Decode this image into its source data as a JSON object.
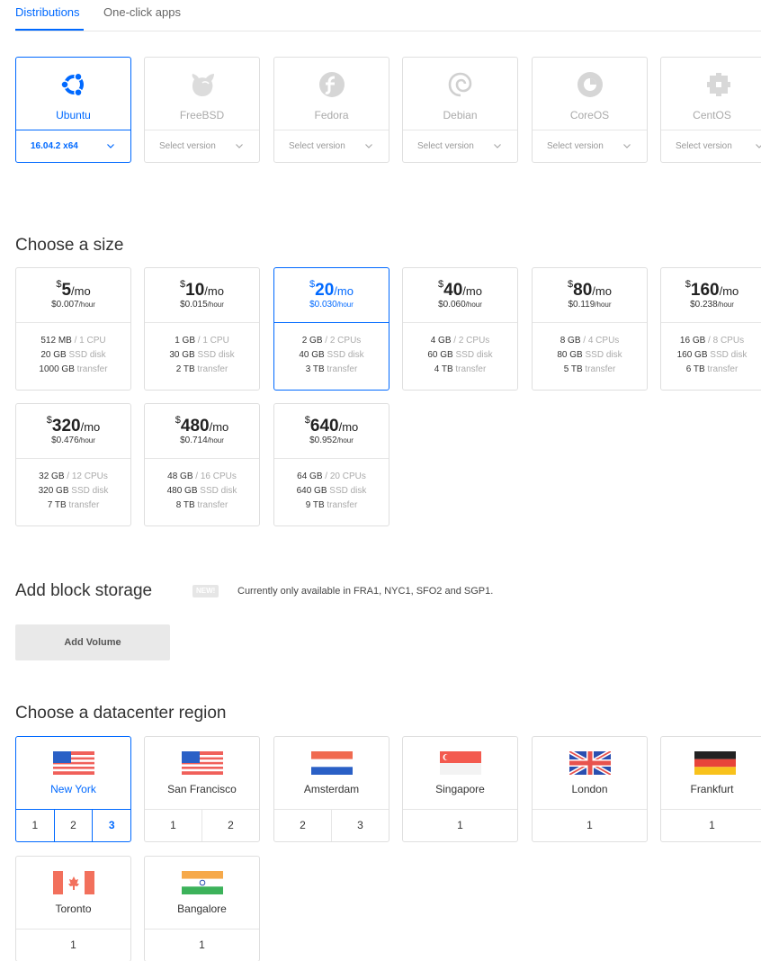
{
  "tabs": [
    {
      "label": "Distributions",
      "active": true
    },
    {
      "label": "One-click apps",
      "active": false
    }
  ],
  "distributions": [
    {
      "name": "Ubuntu",
      "version": "16.04.2 x64",
      "selected": true,
      "icon": "ubuntu-icon"
    },
    {
      "name": "FreeBSD",
      "version": "Select version",
      "selected": false,
      "icon": "freebsd-icon"
    },
    {
      "name": "Fedora",
      "version": "Select version",
      "selected": false,
      "icon": "fedora-icon"
    },
    {
      "name": "Debian",
      "version": "Select version",
      "selected": false,
      "icon": "debian-icon"
    },
    {
      "name": "CoreOS",
      "version": "Select version",
      "selected": false,
      "icon": "coreos-icon"
    },
    {
      "name": "CentOS",
      "version": "Select version",
      "selected": false,
      "icon": "centos-icon"
    }
  ],
  "size_section": {
    "title": "Choose a size",
    "sizes": [
      {
        "currency": "$",
        "price": "5",
        "per": "/mo",
        "hourly": "$0.007",
        "hourly_unit": "/hour",
        "ram": "512 MB",
        "cpu": "1 CPU",
        "disk": "20 GB",
        "disk_type": "SSD disk",
        "transfer": "1000 GB",
        "transfer_label": "transfer",
        "selected": false
      },
      {
        "currency": "$",
        "price": "10",
        "per": "/mo",
        "hourly": "$0.015",
        "hourly_unit": "/hour",
        "ram": "1 GB",
        "cpu": "1 CPU",
        "disk": "30 GB",
        "disk_type": "SSD disk",
        "transfer": "2 TB",
        "transfer_label": "transfer",
        "selected": false
      },
      {
        "currency": "$",
        "price": "20",
        "per": "/mo",
        "hourly": "$0.030",
        "hourly_unit": "/hour",
        "ram": "2 GB",
        "cpu": "2 CPUs",
        "disk": "40 GB",
        "disk_type": "SSD disk",
        "transfer": "3 TB",
        "transfer_label": "transfer",
        "selected": true
      },
      {
        "currency": "$",
        "price": "40",
        "per": "/mo",
        "hourly": "$0.060",
        "hourly_unit": "/hour",
        "ram": "4 GB",
        "cpu": "2 CPUs",
        "disk": "60 GB",
        "disk_type": "SSD disk",
        "transfer": "4 TB",
        "transfer_label": "transfer",
        "selected": false
      },
      {
        "currency": "$",
        "price": "80",
        "per": "/mo",
        "hourly": "$0.119",
        "hourly_unit": "/hour",
        "ram": "8 GB",
        "cpu": "4 CPUs",
        "disk": "80 GB",
        "disk_type": "SSD disk",
        "transfer": "5 TB",
        "transfer_label": "transfer",
        "selected": false
      },
      {
        "currency": "$",
        "price": "160",
        "per": "/mo",
        "hourly": "$0.238",
        "hourly_unit": "/hour",
        "ram": "16 GB",
        "cpu": "8 CPUs",
        "disk": "160 GB",
        "disk_type": "SSD disk",
        "transfer": "6 TB",
        "transfer_label": "transfer",
        "selected": false
      },
      {
        "currency": "$",
        "price": "320",
        "per": "/mo",
        "hourly": "$0.476",
        "hourly_unit": "/hour",
        "ram": "32 GB",
        "cpu": "12 CPUs",
        "disk": "320 GB",
        "disk_type": "SSD disk",
        "transfer": "7 TB",
        "transfer_label": "transfer",
        "selected": false
      },
      {
        "currency": "$",
        "price": "480",
        "per": "/mo",
        "hourly": "$0.714",
        "hourly_unit": "/hour",
        "ram": "48 GB",
        "cpu": "16 CPUs",
        "disk": "480 GB",
        "disk_type": "SSD disk",
        "transfer": "8 TB",
        "transfer_label": "transfer",
        "selected": false
      },
      {
        "currency": "$",
        "price": "640",
        "per": "/mo",
        "hourly": "$0.952",
        "hourly_unit": "/hour",
        "ram": "64 GB",
        "cpu": "20 CPUs",
        "disk": "640 GB",
        "disk_type": "SSD disk",
        "transfer": "9 TB",
        "transfer_label": "transfer",
        "selected": false
      }
    ]
  },
  "block_storage": {
    "title": "Add block storage",
    "badge": "NEW!",
    "note": "Currently only available in FRA1, NYC1, SFO2 and SGP1.",
    "button_label": "Add Volume"
  },
  "region_section": {
    "title": "Choose a datacenter region",
    "regions": [
      {
        "name": "New York",
        "flag": "us-flag-icon",
        "numbers": [
          "1",
          "2",
          "3"
        ],
        "active_number": "3",
        "selected": true
      },
      {
        "name": "San Francisco",
        "flag": "us-flag-icon",
        "numbers": [
          "1",
          "2"
        ],
        "active_number": null,
        "selected": false
      },
      {
        "name": "Amsterdam",
        "flag": "netherlands-flag-icon",
        "numbers": [
          "2",
          "3"
        ],
        "active_number": null,
        "selected": false
      },
      {
        "name": "Singapore",
        "flag": "singapore-flag-icon",
        "numbers": [
          "1"
        ],
        "active_number": null,
        "selected": false
      },
      {
        "name": "London",
        "flag": "uk-flag-icon",
        "numbers": [
          "1"
        ],
        "active_number": null,
        "selected": false
      },
      {
        "name": "Frankfurt",
        "flag": "germany-flag-icon",
        "numbers": [
          "1"
        ],
        "active_number": null,
        "selected": false
      },
      {
        "name": "Toronto",
        "flag": "canada-flag-icon",
        "numbers": [
          "1"
        ],
        "active_number": null,
        "selected": false
      },
      {
        "name": "Bangalore",
        "flag": "india-flag-icon",
        "numbers": [
          "1"
        ],
        "active_number": null,
        "selected": false
      }
    ]
  },
  "colors": {
    "accent": "#0069ff",
    "border": "#dfdfdf",
    "muted_text": "#aaaaaa"
  }
}
